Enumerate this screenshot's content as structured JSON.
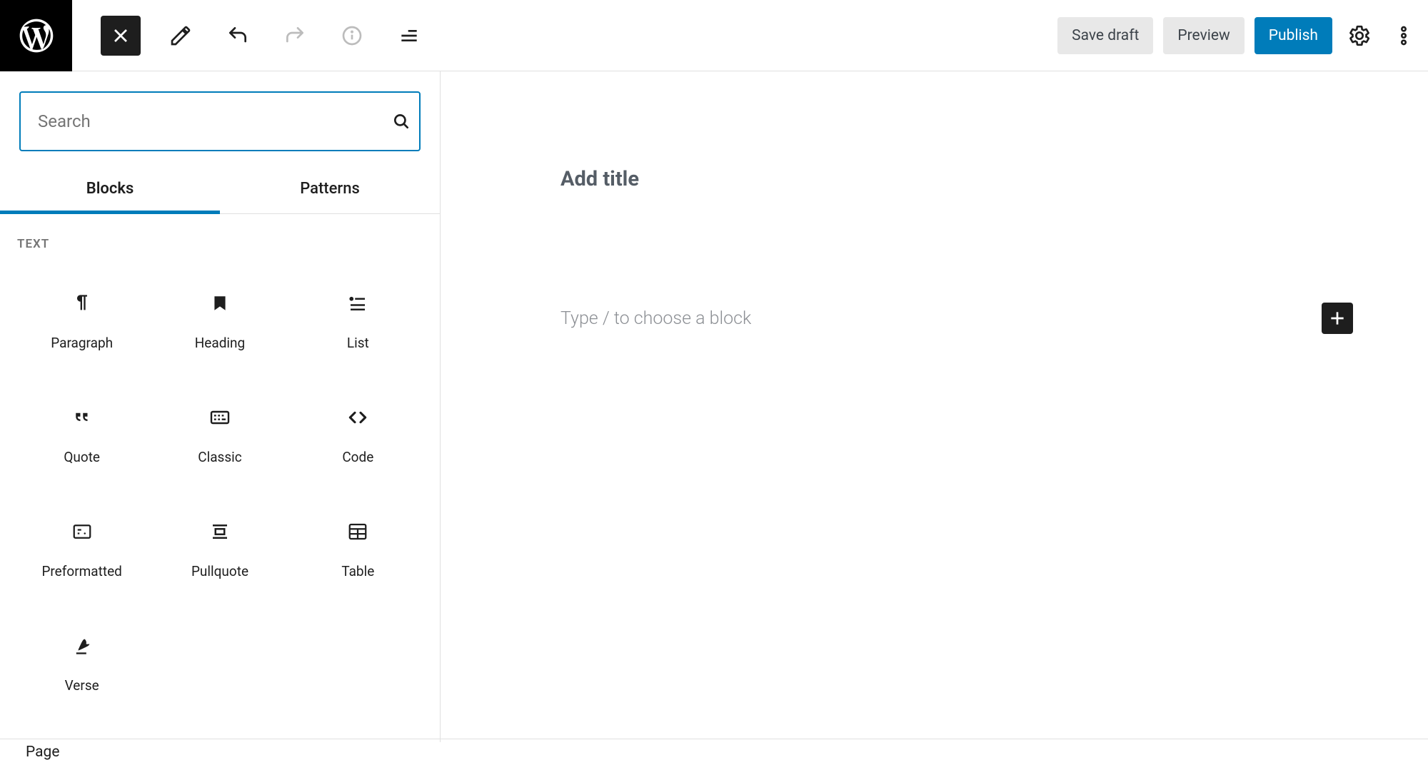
{
  "topbar": {
    "save_draft": "Save draft",
    "preview": "Preview",
    "publish": "Publish"
  },
  "inserter": {
    "search_placeholder": "Search",
    "tabs": {
      "blocks": "Blocks",
      "patterns": "Patterns"
    },
    "category": "TEXT",
    "blocks": [
      {
        "label": "Paragraph"
      },
      {
        "label": "Heading"
      },
      {
        "label": "List"
      },
      {
        "label": "Quote"
      },
      {
        "label": "Classic"
      },
      {
        "label": "Code"
      },
      {
        "label": "Preformatted"
      },
      {
        "label": "Pullquote"
      },
      {
        "label": "Table"
      },
      {
        "label": "Verse"
      }
    ]
  },
  "editor": {
    "title_placeholder": "Add title",
    "block_placeholder": "Type / to choose a block"
  },
  "footer": {
    "breadcrumb": "Page"
  }
}
